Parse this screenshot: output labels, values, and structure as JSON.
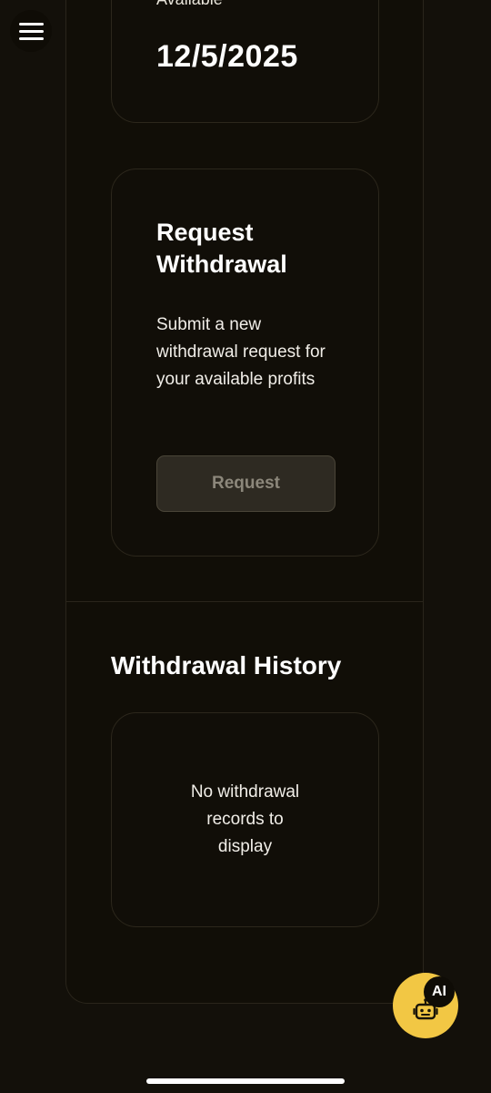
{
  "available_card": {
    "label": "Available",
    "date": "12/5/2025"
  },
  "request_card": {
    "title": "Request Withdrawal",
    "description": "Submit a new withdrawal request for your available profits",
    "button_label": "Request"
  },
  "history": {
    "title": "Withdrawal History",
    "empty_lines": [
      "No withdrawal",
      "records to",
      "display"
    ]
  },
  "ai_fab": {
    "badge_label": "AI",
    "icon": "robot-icon"
  },
  "menu": {
    "icon": "hamburger-menu-icon"
  },
  "colors": {
    "background": "#13100a",
    "accent": "#f2c744",
    "button_disabled_bg": "#2e2a22",
    "button_disabled_text": "#8c877b"
  }
}
